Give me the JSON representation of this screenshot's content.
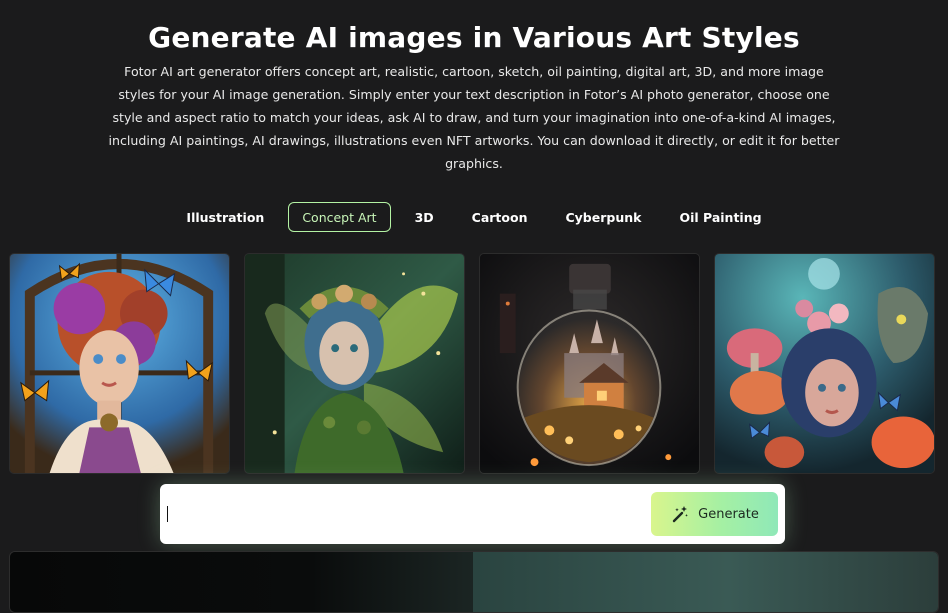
{
  "header": {
    "title": "Generate AI images in Various Art Styles",
    "description": "Fotor AI art generator offers concept art, realistic, cartoon, sketch, oil painting, digital art, 3D, and more image styles for your AI image generation. Simply enter your text description in Fotor’s AI photo generator, choose one style and aspect ratio to match your ideas, ask AI to draw, and turn your imagination into one-of-a-kind AI images, including AI paintings, AI drawings, illustrations even NFT artworks. You can download it directly, or edit it for better graphics."
  },
  "tabs": [
    {
      "label": "Illustration",
      "active": false
    },
    {
      "label": "Concept Art",
      "active": true
    },
    {
      "label": "3D",
      "active": false
    },
    {
      "label": "Cartoon",
      "active": false
    },
    {
      "label": "Cyberpunk",
      "active": false
    },
    {
      "label": "Oil Painting",
      "active": false
    }
  ],
  "gallery": [
    {
      "subject": "red-haired girl with butterflies in stained glass window"
    },
    {
      "subject": "forest fairy with green wings and flower crown"
    },
    {
      "subject": "glowing village inside a glass bottle"
    },
    {
      "subject": "girl with blue hair among mushrooms and creature"
    }
  ],
  "prompt_bar": {
    "value": "",
    "placeholder": "",
    "button_label": "Generate",
    "button_icon": "magic-wand-icon"
  },
  "colors": {
    "background": "#1b1b1c",
    "active_tab_border": "#b4f3a4",
    "button_gradient_start": "#d9f58d",
    "button_gradient_end": "#8fe8b8"
  }
}
